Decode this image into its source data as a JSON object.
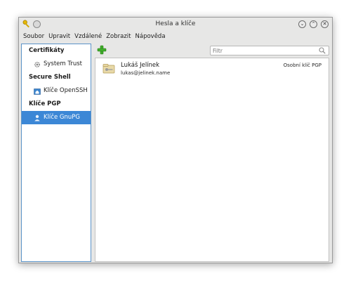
{
  "window": {
    "title": "Hesla a klíče"
  },
  "menubar": {
    "items": [
      "Soubor",
      "Upravit",
      "Vzdálené",
      "Zobrazit",
      "Nápověda"
    ]
  },
  "sidebar": {
    "sections": [
      {
        "header": "Certifikáty",
        "items": [
          {
            "label": "System Trust",
            "icon": "gear-icon"
          }
        ]
      },
      {
        "header": "Secure Shell",
        "items": [
          {
            "label": "Klíče OpenSSH",
            "icon": "home-folder-icon"
          }
        ]
      },
      {
        "header": "Klíče PGP",
        "items": [
          {
            "label": "Klíče GnuPG",
            "icon": "person-icon",
            "selected": true
          }
        ]
      }
    ]
  },
  "toolbar": {
    "filter_placeholder": "Filtr",
    "add_icon": "plus-icon",
    "search_icon": "magnifier-icon"
  },
  "keys": [
    {
      "name": "Lukáš Jelínek",
      "email": "lukas@jelinek.name",
      "type": "Osobní klíč PGP",
      "icon": "key-icon"
    }
  ],
  "colors": {
    "selection": "#3c87d6",
    "sidebar_border": "#5b93c8",
    "add_green": "#3fae2a"
  }
}
